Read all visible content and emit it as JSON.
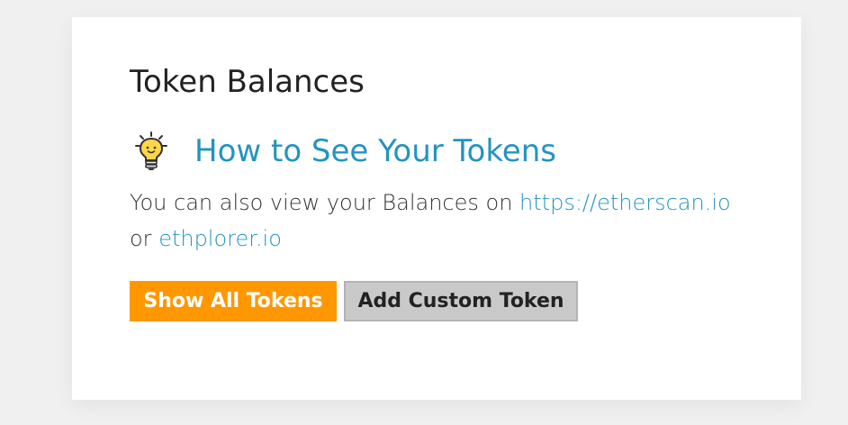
{
  "panel": {
    "title": "Token Balances",
    "howto": {
      "icon": "lightbulb-icon",
      "label": "How to See Your Tokens"
    },
    "description": {
      "prefix": "You can also view your Balances on ",
      "link1_label": "https://etherscan.io",
      "middle": "or ",
      "link2_label": "ethplorer.io"
    },
    "buttons": {
      "show_all_label": "Show All Tokens",
      "add_custom_label": "Add Custom Token"
    }
  },
  "colors": {
    "link": "#2394c0",
    "primary_button": "#ff9800",
    "secondary_button": "#c9c9c9",
    "text": "#222222"
  }
}
